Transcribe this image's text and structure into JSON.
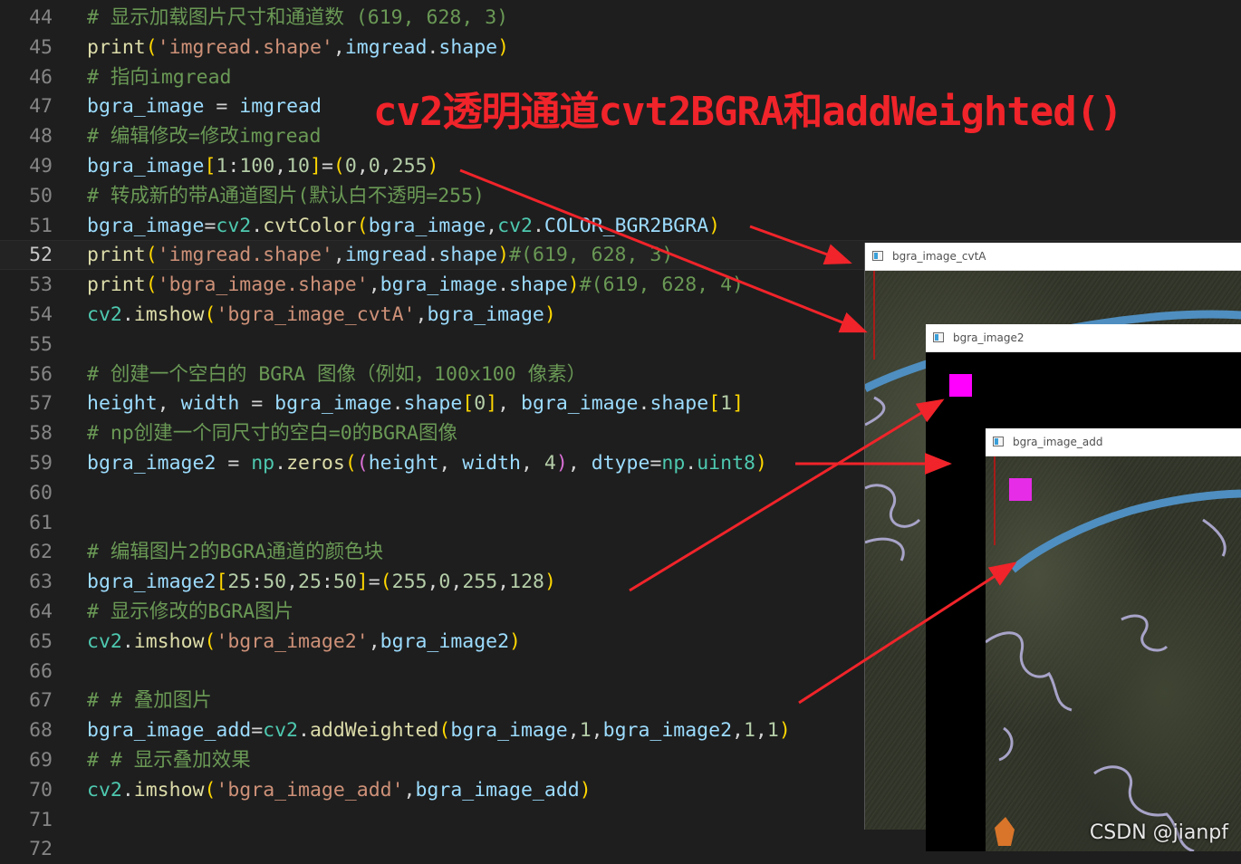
{
  "lines": [
    {
      "n": "44",
      "tokens": [
        {
          "t": "# 显示加载图片尺寸和通道数 (619, 628, 3)",
          "c": "cmt"
        }
      ]
    },
    {
      "n": "45",
      "tokens": [
        {
          "t": "print",
          "c": "fn"
        },
        {
          "t": "(",
          "c": "p1"
        },
        {
          "t": "'imgread.shape'",
          "c": "str"
        },
        {
          "t": ",",
          "c": "op"
        },
        {
          "t": "imgread",
          "c": "var"
        },
        {
          "t": ".",
          "c": "op"
        },
        {
          "t": "shape",
          "c": "var"
        },
        {
          "t": ")",
          "c": "p1"
        }
      ]
    },
    {
      "n": "46",
      "tokens": [
        {
          "t": "# 指向imgread",
          "c": "cmt"
        }
      ]
    },
    {
      "n": "47",
      "tokens": [
        {
          "t": "bgra_image",
          "c": "var"
        },
        {
          "t": " = ",
          "c": "op"
        },
        {
          "t": "imgread",
          "c": "var"
        }
      ]
    },
    {
      "n": "48",
      "tokens": [
        {
          "t": "# 编辑修改=修改imgread",
          "c": "cmt"
        }
      ]
    },
    {
      "n": "49",
      "tokens": [
        {
          "t": "bgra_image",
          "c": "var"
        },
        {
          "t": "[",
          "c": "p1"
        },
        {
          "t": "1",
          "c": "num"
        },
        {
          "t": ":",
          "c": "op"
        },
        {
          "t": "100",
          "c": "num"
        },
        {
          "t": ",",
          "c": "op"
        },
        {
          "t": "10",
          "c": "num"
        },
        {
          "t": "]",
          "c": "p1"
        },
        {
          "t": "=",
          "c": "op"
        },
        {
          "t": "(",
          "c": "p1"
        },
        {
          "t": "0",
          "c": "num"
        },
        {
          "t": ",",
          "c": "op"
        },
        {
          "t": "0",
          "c": "num"
        },
        {
          "t": ",",
          "c": "op"
        },
        {
          "t": "255",
          "c": "num"
        },
        {
          "t": ")",
          "c": "p1"
        }
      ]
    },
    {
      "n": "50",
      "tokens": [
        {
          "t": "# 转成新的带A通道图片(默认白不透明=255)",
          "c": "cmt"
        }
      ]
    },
    {
      "n": "51",
      "tokens": [
        {
          "t": "bgra_image",
          "c": "var"
        },
        {
          "t": "=",
          "c": "op"
        },
        {
          "t": "cv2",
          "c": "mod"
        },
        {
          "t": ".",
          "c": "op"
        },
        {
          "t": "cvtColor",
          "c": "fn"
        },
        {
          "t": "(",
          "c": "p1"
        },
        {
          "t": "bgra_image",
          "c": "var"
        },
        {
          "t": ",",
          "c": "op"
        },
        {
          "t": "cv2",
          "c": "mod"
        },
        {
          "t": ".",
          "c": "op"
        },
        {
          "t": "COLOR_BGR2BGRA",
          "c": "var"
        },
        {
          "t": ")",
          "c": "p1"
        }
      ]
    },
    {
      "n": "52",
      "current": true,
      "tokens": [
        {
          "t": "print",
          "c": "fn"
        },
        {
          "t": "(",
          "c": "p1"
        },
        {
          "t": "'imgread.shape'",
          "c": "str"
        },
        {
          "t": ",",
          "c": "op"
        },
        {
          "t": "imgread",
          "c": "var"
        },
        {
          "t": ".",
          "c": "op"
        },
        {
          "t": "shape",
          "c": "var"
        },
        {
          "t": ")",
          "c": "p1"
        },
        {
          "t": "#(619, 628, 3)",
          "c": "cmt"
        }
      ]
    },
    {
      "n": "53",
      "tokens": [
        {
          "t": "print",
          "c": "fn"
        },
        {
          "t": "(",
          "c": "p1"
        },
        {
          "t": "'bgra_image.shape'",
          "c": "str"
        },
        {
          "t": ",",
          "c": "op"
        },
        {
          "t": "bgra_image",
          "c": "var"
        },
        {
          "t": ".",
          "c": "op"
        },
        {
          "t": "shape",
          "c": "var"
        },
        {
          "t": ")",
          "c": "p1"
        },
        {
          "t": "#(619, 628, 4)",
          "c": "cmt"
        }
      ]
    },
    {
      "n": "54",
      "tokens": [
        {
          "t": "cv2",
          "c": "mod"
        },
        {
          "t": ".",
          "c": "op"
        },
        {
          "t": "imshow",
          "c": "fn"
        },
        {
          "t": "(",
          "c": "p1"
        },
        {
          "t": "'bgra_image_cvtA'",
          "c": "str"
        },
        {
          "t": ",",
          "c": "op"
        },
        {
          "t": "bgra_image",
          "c": "var"
        },
        {
          "t": ")",
          "c": "p1"
        }
      ]
    },
    {
      "n": "55",
      "tokens": []
    },
    {
      "n": "56",
      "tokens": [
        {
          "t": "# 创建一个空白的 BGRA 图像（例如，100x100 像素）",
          "c": "cmt"
        }
      ]
    },
    {
      "n": "57",
      "tokens": [
        {
          "t": "height",
          "c": "var"
        },
        {
          "t": ", ",
          "c": "op"
        },
        {
          "t": "width",
          "c": "var"
        },
        {
          "t": " = ",
          "c": "op"
        },
        {
          "t": "bgra_image",
          "c": "var"
        },
        {
          "t": ".",
          "c": "op"
        },
        {
          "t": "shape",
          "c": "var"
        },
        {
          "t": "[",
          "c": "p1"
        },
        {
          "t": "0",
          "c": "num"
        },
        {
          "t": "]",
          "c": "p1"
        },
        {
          "t": ", ",
          "c": "op"
        },
        {
          "t": "bgra_image",
          "c": "var"
        },
        {
          "t": ".",
          "c": "op"
        },
        {
          "t": "shape",
          "c": "var"
        },
        {
          "t": "[",
          "c": "p1"
        },
        {
          "t": "1",
          "c": "num"
        },
        {
          "t": "]",
          "c": "p1"
        }
      ]
    },
    {
      "n": "58",
      "tokens": [
        {
          "t": "# np创建一个同尺寸的空白=0的BGRA图像",
          "c": "cmt"
        }
      ]
    },
    {
      "n": "59",
      "tokens": [
        {
          "t": "bgra_image2",
          "c": "var"
        },
        {
          "t": " = ",
          "c": "op"
        },
        {
          "t": "np",
          "c": "mod"
        },
        {
          "t": ".",
          "c": "op"
        },
        {
          "t": "zeros",
          "c": "fn"
        },
        {
          "t": "(",
          "c": "p1"
        },
        {
          "t": "(",
          "c": "p2"
        },
        {
          "t": "height",
          "c": "var"
        },
        {
          "t": ", ",
          "c": "op"
        },
        {
          "t": "width",
          "c": "var"
        },
        {
          "t": ", ",
          "c": "op"
        },
        {
          "t": "4",
          "c": "num"
        },
        {
          "t": ")",
          "c": "p2"
        },
        {
          "t": ", ",
          "c": "op"
        },
        {
          "t": "dtype",
          "c": "var"
        },
        {
          "t": "=",
          "c": "op"
        },
        {
          "t": "np",
          "c": "mod"
        },
        {
          "t": ".",
          "c": "op"
        },
        {
          "t": "uint8",
          "c": "mod"
        },
        {
          "t": ")",
          "c": "p1"
        }
      ]
    },
    {
      "n": "60",
      "tokens": []
    },
    {
      "n": "61",
      "tokens": []
    },
    {
      "n": "62",
      "tokens": [
        {
          "t": "# 编辑图片2的BGRA通道的颜色块",
          "c": "cmt"
        }
      ]
    },
    {
      "n": "63",
      "tokens": [
        {
          "t": "bgra_image2",
          "c": "var"
        },
        {
          "t": "[",
          "c": "p1"
        },
        {
          "t": "25",
          "c": "num"
        },
        {
          "t": ":",
          "c": "op"
        },
        {
          "t": "50",
          "c": "num"
        },
        {
          "t": ",",
          "c": "op"
        },
        {
          "t": "25",
          "c": "num"
        },
        {
          "t": ":",
          "c": "op"
        },
        {
          "t": "50",
          "c": "num"
        },
        {
          "t": "]",
          "c": "p1"
        },
        {
          "t": "=",
          "c": "op"
        },
        {
          "t": "(",
          "c": "p1"
        },
        {
          "t": "255",
          "c": "num"
        },
        {
          "t": ",",
          "c": "op"
        },
        {
          "t": "0",
          "c": "num"
        },
        {
          "t": ",",
          "c": "op"
        },
        {
          "t": "255",
          "c": "num"
        },
        {
          "t": ",",
          "c": "op"
        },
        {
          "t": "128",
          "c": "num"
        },
        {
          "t": ")",
          "c": "p1"
        }
      ]
    },
    {
      "n": "64",
      "tokens": [
        {
          "t": "# 显示修改的BGRA图片",
          "c": "cmt"
        }
      ]
    },
    {
      "n": "65",
      "tokens": [
        {
          "t": "cv2",
          "c": "mod"
        },
        {
          "t": ".",
          "c": "op"
        },
        {
          "t": "imshow",
          "c": "fn"
        },
        {
          "t": "(",
          "c": "p1"
        },
        {
          "t": "'bgra_image2'",
          "c": "str"
        },
        {
          "t": ",",
          "c": "op"
        },
        {
          "t": "bgra_image2",
          "c": "var"
        },
        {
          "t": ")",
          "c": "p1"
        }
      ]
    },
    {
      "n": "66",
      "tokens": []
    },
    {
      "n": "67",
      "tokens": [
        {
          "t": "# # 叠加图片",
          "c": "cmt"
        }
      ]
    },
    {
      "n": "68",
      "tokens": [
        {
          "t": "bgra_image_add",
          "c": "var"
        },
        {
          "t": "=",
          "c": "op"
        },
        {
          "t": "cv2",
          "c": "mod"
        },
        {
          "t": ".",
          "c": "op"
        },
        {
          "t": "addWeighted",
          "c": "fn"
        },
        {
          "t": "(",
          "c": "p1"
        },
        {
          "t": "bgra_image",
          "c": "var"
        },
        {
          "t": ",",
          "c": "op"
        },
        {
          "t": "1",
          "c": "num"
        },
        {
          "t": ",",
          "c": "op"
        },
        {
          "t": "bgra_image2",
          "c": "var"
        },
        {
          "t": ",",
          "c": "op"
        },
        {
          "t": "1",
          "c": "num"
        },
        {
          "t": ",",
          "c": "op"
        },
        {
          "t": "1",
          "c": "num"
        },
        {
          "t": ")",
          "c": "p1"
        }
      ]
    },
    {
      "n": "69",
      "tokens": [
        {
          "t": "# # 显示叠加效果",
          "c": "cmt"
        }
      ]
    },
    {
      "n": "70",
      "tokens": [
        {
          "t": "cv2",
          "c": "mod"
        },
        {
          "t": ".",
          "c": "op"
        },
        {
          "t": "imshow",
          "c": "fn"
        },
        {
          "t": "(",
          "c": "p1"
        },
        {
          "t": "'bgra_image_add'",
          "c": "str"
        },
        {
          "t": ",",
          "c": "op"
        },
        {
          "t": "bgra_image_add",
          "c": "var"
        },
        {
          "t": ")",
          "c": "p1"
        }
      ]
    },
    {
      "n": "71",
      "tokens": []
    },
    {
      "n": "72",
      "tokens": []
    }
  ],
  "annotation": {
    "title": "cv2透明通道cvt2BGRA和addWeighted()"
  },
  "windows": {
    "cvtA": {
      "title": "bgra_image_cvtA"
    },
    "image2": {
      "title": "bgra_image2"
    },
    "add": {
      "title": "bgra_image_add"
    }
  },
  "watermark": "CSDN @jianpf",
  "colors": {
    "editor_bg": "#1e1e1e",
    "annotation_red": "#f0242a",
    "magenta_block": "#ff00ff",
    "magenta_blended": "#e62ce6",
    "river_blue": "#4f8ec0"
  }
}
